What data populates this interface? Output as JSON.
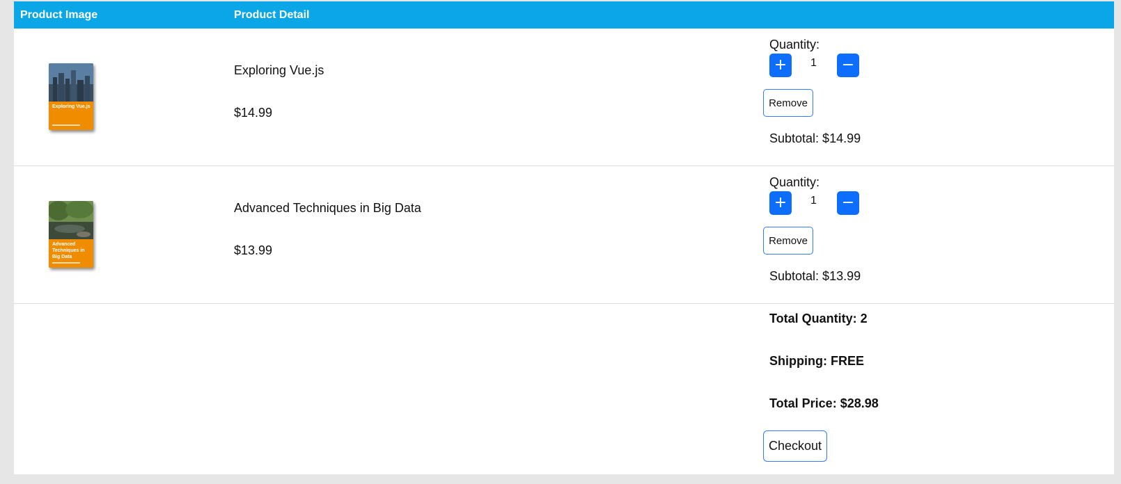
{
  "header": {
    "col_image": "Product Image",
    "col_detail": "Product Detail"
  },
  "items": [
    {
      "name": "Exploring Vue.js",
      "price": "$14.99",
      "cover_title": "Exploring Vue.js",
      "quantity_label": "Quantity:",
      "quantity": "1",
      "increment_label": "+",
      "decrement_label": "−",
      "remove_label": "Remove",
      "subtotal": "Subtotal: $14.99"
    },
    {
      "name": "Advanced Techniques in Big Data",
      "price": "$13.99",
      "cover_title": "Advanced Techniques in Big Data",
      "quantity_label": "Quantity:",
      "quantity": "1",
      "increment_label": "+",
      "decrement_label": "−",
      "remove_label": "Remove",
      "subtotal": "Subtotal: $13.99"
    }
  ],
  "summary": {
    "total_quantity": "Total Quantity: 2",
    "shipping": "Shipping: FREE",
    "total_price": "Total Price: $28.98",
    "checkout_label": "Checkout"
  },
  "colors": {
    "header": "#0aa6e6",
    "button_primary": "#0d6efd",
    "book_cover": "#f08c00"
  }
}
